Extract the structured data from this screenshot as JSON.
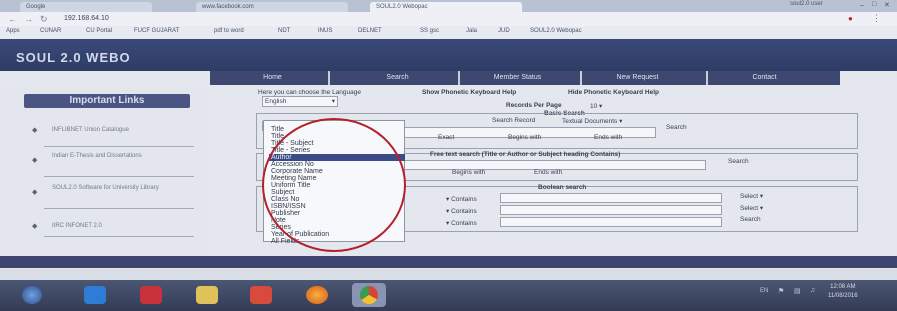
{
  "browser": {
    "tabs": [
      {
        "label": "Google",
        "icon": "google-icon"
      },
      {
        "label": "www.facebook.com",
        "icon": "facebook-icon"
      },
      {
        "label": "SOUL2.0 Webopac",
        "active": true
      }
    ],
    "user_label": "soul2.0 user",
    "url": "192.168.64.10",
    "bookmarks": [
      "Apps",
      "CUNAR",
      "CU Portal",
      "FUCF GUJARAT",
      "pdf to word",
      "NDT",
      "INUS",
      "DELNET",
      "SS gsc",
      "Jala",
      "JUD",
      "SOUL2.0 Webopac"
    ]
  },
  "site": {
    "logo": "SOUL 2.0 WEBO",
    "menu": [
      "Home",
      "Search",
      "Member Status",
      "New Request",
      "Contact"
    ],
    "important_links_title": "Important Links",
    "links": [
      "INFLIBNET Union Catalogue",
      "Indian E-Thesis and Dissertations",
      "SOUL2.0 Software for University Library",
      "IIRC INFONET 2.0"
    ]
  },
  "search": {
    "language_prompt": "Here you can choose the Language",
    "show_keyboard": "Show Phonetic Keyboard Help",
    "hide_keyboard": "Hide Phonetic Keyboard Help",
    "language_value": "English",
    "records_per_page_label": "Records Per Page",
    "records_per_page_value": "10",
    "basic_search_label": "Basic Search",
    "search_record_label": "Search Record",
    "search_record_value": "Textual Documents",
    "exact_label": "Exact",
    "begins_label": "Begins with",
    "ends_label": "Ends with",
    "search_button": "Search",
    "free_text_label": "Free text search (Title or Author or Subject heading Contains)",
    "boolean_label": "Boolean search",
    "contains_label": "Contains",
    "select_label": "Select",
    "field_options": [
      "Title",
      "Title",
      "Title - Subject",
      "Title - Series",
      "Author",
      "Accession No",
      "Corporate Name",
      "Meeting Name",
      "Uniform Title",
      "Subject",
      "Class No",
      "ISBN/ISSN",
      "Publisher",
      "Note",
      "Series",
      "Year of Publication",
      "All Fields"
    ],
    "selected_option_index": 4
  },
  "taskbar": {
    "clock_time": "12:08 AM",
    "clock_date": "11/08/2016",
    "lang": "EN"
  },
  "colors": {
    "banner": "#2e3c66",
    "menubar": "#3d4770",
    "annotation_circle": "#b5202a"
  }
}
